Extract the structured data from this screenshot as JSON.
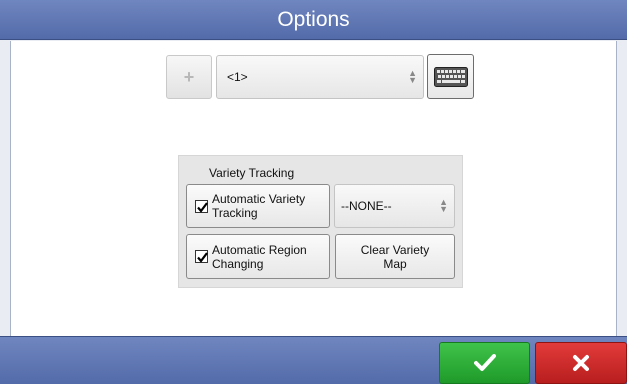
{
  "window": {
    "title": "Options"
  },
  "toolbar": {
    "add_label": "+",
    "selector_value": "<1>"
  },
  "variety_tracking": {
    "title": "Variety Tracking",
    "auto_variety": {
      "label_line1": "Automatic Variety",
      "label_line2": "Tracking",
      "checked": true
    },
    "variety_select": {
      "value": "--NONE--"
    },
    "auto_region": {
      "label_line1": "Automatic Region",
      "label_line2": "Changing",
      "checked": true
    },
    "clear_map": {
      "label_line1": "Clear Variety",
      "label_line2": "Map"
    }
  },
  "footer": {
    "ok_icon": "checkmark-icon",
    "cancel_icon": "x-icon"
  },
  "colors": {
    "title_bar": "#5f76b4",
    "ok": "#2aae36",
    "cancel": "#cf2b2b"
  }
}
